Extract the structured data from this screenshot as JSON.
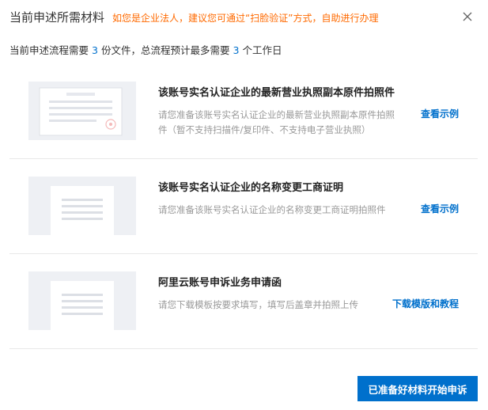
{
  "header": {
    "title": "当前申述所需材料",
    "tip": "如您是企业法人，建议您可通过“扫脸验证”方式，自助进行办理",
    "close_icon": "close-icon"
  },
  "summary": {
    "prefix": "当前申述流程需要",
    "file_count": "3",
    "middle": "份文件，总流程预计最多需要",
    "days": "3",
    "suffix": "个工作日"
  },
  "items": [
    {
      "title": "该账号实名认证企业的最新营业执照副本原件拍照件",
      "desc": "请您准备该账号实名认证企业的最新营业执照副本原件拍照件（暂不支持扫描件/复印件、不支持电子营业执照）",
      "link": "查看示例",
      "thumb_icon": "business-license-thumbnail"
    },
    {
      "title": "该账号实名认证企业的名称变更工商证明",
      "desc": "请您准备该账号实名认证企业的名称变更工商证明拍照件",
      "link": "查看示例",
      "thumb_icon": "document-thumbnail"
    },
    {
      "title": "阿里云账号申诉业务申请函",
      "desc": "请您下载模板按要求填写，填写后盖章并拍照上传",
      "link": "下载模版和教程",
      "thumb_icon": "document-thumbnail"
    }
  ],
  "footer": {
    "start_button": "已准备好材料开始申诉"
  }
}
